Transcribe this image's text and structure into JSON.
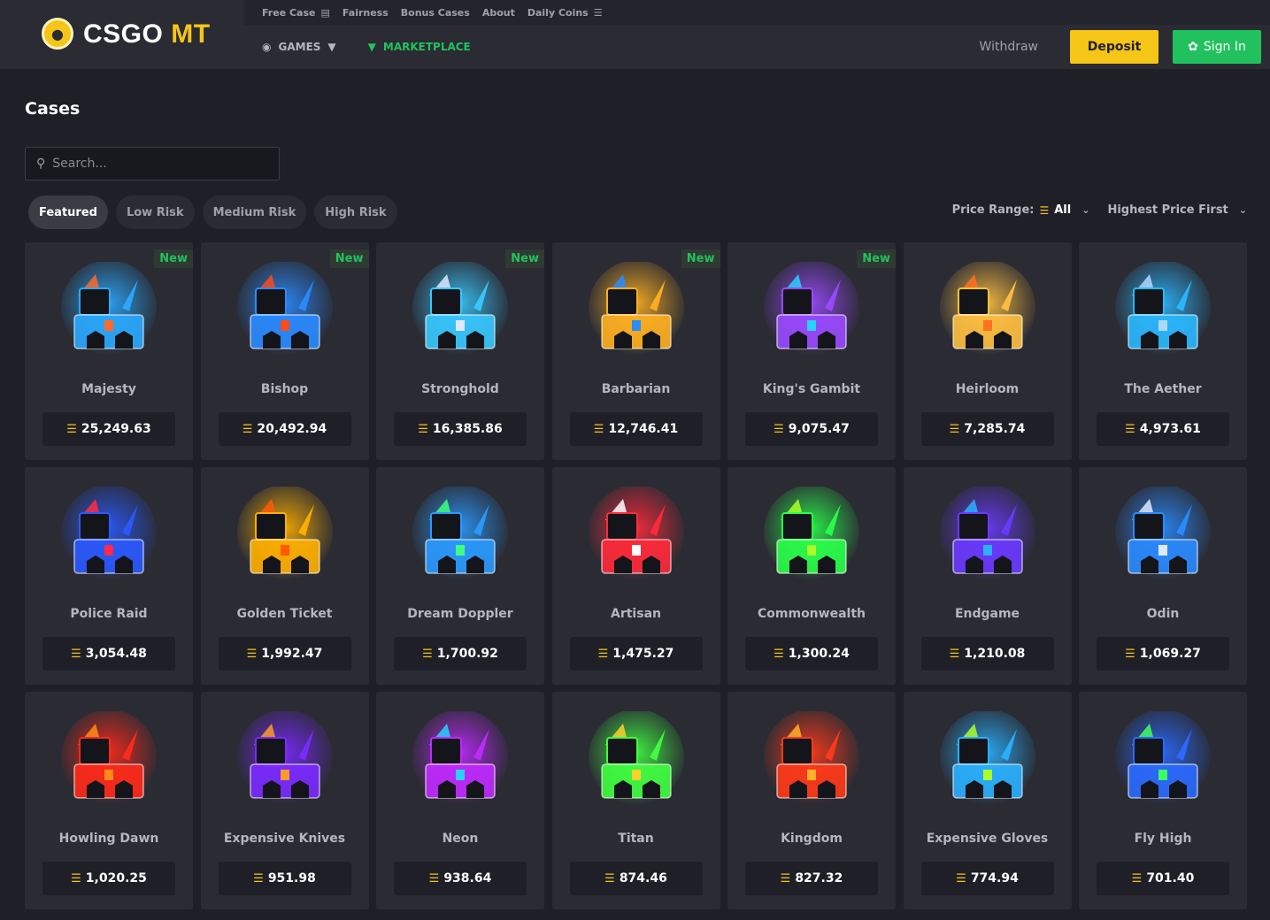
{
  "header": {
    "logo_text": "CSGO",
    "logo_accent": "MT",
    "topbar": [
      {
        "label": "Free Case",
        "icon": "gift-icon"
      },
      {
        "label": "Fairness"
      },
      {
        "label": "Bonus Cases"
      },
      {
        "label": "About"
      },
      {
        "label": "Daily Coins",
        "icon": "coins-icon"
      }
    ],
    "nav": {
      "games": "GAMES",
      "marketplace": "MARKETPLACE"
    },
    "withdraw": "Withdraw",
    "deposit": "Deposit",
    "signin": "Sign In"
  },
  "page": {
    "title": "Cases",
    "search_placeholder": "Search..."
  },
  "filters": [
    "Featured",
    "Low Risk",
    "Medium Risk",
    "High Risk"
  ],
  "active_filter": "Featured",
  "sort": {
    "price_range_label": "Price Range:",
    "price_range_value": "All",
    "order": "Highest Price First"
  },
  "colors": {
    "accent_gold": "#f5c518",
    "accent_green": "#21c25e",
    "background": "#1f2027",
    "card": "#2a2b33"
  },
  "new_label": "New",
  "cases": [
    {
      "name": "Majesty",
      "price": "25,249.63",
      "new": true,
      "hue": "#2aa9ff",
      "hue2": "#ff6a2a"
    },
    {
      "name": "Bishop",
      "price": "20,492.94",
      "new": true,
      "hue": "#2a8bff",
      "hue2": "#ff4a1a"
    },
    {
      "name": "Stronghold",
      "price": "16,385.86",
      "new": true,
      "hue": "#38c8ff",
      "hue2": "#e0e8ff"
    },
    {
      "name": "Barbarian",
      "price": "12,746.41",
      "new": true,
      "hue": "#ffb020",
      "hue2": "#2a8bff"
    },
    {
      "name": "King's Gambit",
      "price": "9,075.47",
      "new": true,
      "hue": "#9a4aff",
      "hue2": "#2ad0ff"
    },
    {
      "name": "Heirloom",
      "price": "7,285.74",
      "new": false,
      "hue": "#ffc040",
      "hue2": "#ff7020"
    },
    {
      "name": "The Aether",
      "price": "4,973.61",
      "new": false,
      "hue": "#2ab8ff",
      "hue2": "#b0d8ff"
    },
    {
      "name": "Police Raid",
      "price": "3,054.48",
      "new": false,
      "hue": "#2a5aff",
      "hue2": "#ff2a4a"
    },
    {
      "name": "Golden Ticket",
      "price": "1,992.47",
      "new": false,
      "hue": "#ffb000",
      "hue2": "#ff5a00"
    },
    {
      "name": "Dream Doppler",
      "price": "1,700.92",
      "new": false,
      "hue": "#2a9aff",
      "hue2": "#40ff80"
    },
    {
      "name": "Artisan",
      "price": "1,475.27",
      "new": false,
      "hue": "#ff2a3a",
      "hue2": "#ffffff"
    },
    {
      "name": "Commonwealth",
      "price": "1,300.24",
      "new": false,
      "hue": "#2aff4a",
      "hue2": "#aaff2a"
    },
    {
      "name": "Endgame",
      "price": "1,210.08",
      "new": false,
      "hue": "#6a3aff",
      "hue2": "#2ab0ff"
    },
    {
      "name": "Odin",
      "price": "1,069.27",
      "new": false,
      "hue": "#2a8bff",
      "hue2": "#e0e8ff"
    },
    {
      "name": "Howling Dawn",
      "price": "1,020.25",
      "new": false,
      "hue": "#ff2a1a",
      "hue2": "#ff8a1a"
    },
    {
      "name": "Expensive Knives",
      "price": "951.98",
      "new": false,
      "hue": "#7a2aff",
      "hue2": "#ff9a2a"
    },
    {
      "name": "Neon",
      "price": "938.64",
      "new": false,
      "hue": "#c02aff",
      "hue2": "#2ad0ff"
    },
    {
      "name": "Titan",
      "price": "874.46",
      "new": false,
      "hue": "#40ff40",
      "hue2": "#ffd02a"
    },
    {
      "name": "Kingdom",
      "price": "827.32",
      "new": false,
      "hue": "#ff3a1a",
      "hue2": "#ffb02a"
    },
    {
      "name": "Expensive Gloves",
      "price": "774.94",
      "new": false,
      "hue": "#2ab0ff",
      "hue2": "#aaff2a"
    },
    {
      "name": "Fly High",
      "price": "701.40",
      "new": false,
      "hue": "#2a6aff",
      "hue2": "#40ff60"
    }
  ]
}
